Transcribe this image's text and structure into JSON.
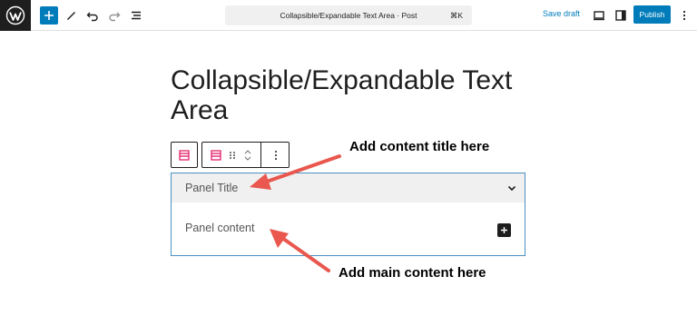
{
  "header": {
    "document_title": "Collapsible/Expandable Text Area · Post",
    "shortcut": "⌘K",
    "save_draft": "Save draft",
    "publish": "Publish"
  },
  "icons": {
    "logo": "wordpress-logo",
    "add": "plus-icon",
    "tools": "pen-icon",
    "undo": "undo-icon",
    "redo": "redo-icon",
    "outline": "list-view-icon",
    "preview": "desktop-preview-icon",
    "sidebar": "sidebar-toggle-icon",
    "options": "more-vertical-icon"
  },
  "editor": {
    "post_title": "Collapsible/Expandable Text Area",
    "panel_title": "Panel Title",
    "panel_content": "Panel content"
  },
  "annotations": {
    "title_hint": "Add content title here",
    "content_hint": "Add main content here"
  },
  "colors": {
    "accent": "#007cba",
    "block_icon": "#e0115f",
    "arrow": "#e9574e",
    "panel_border": "#4a90c2"
  }
}
